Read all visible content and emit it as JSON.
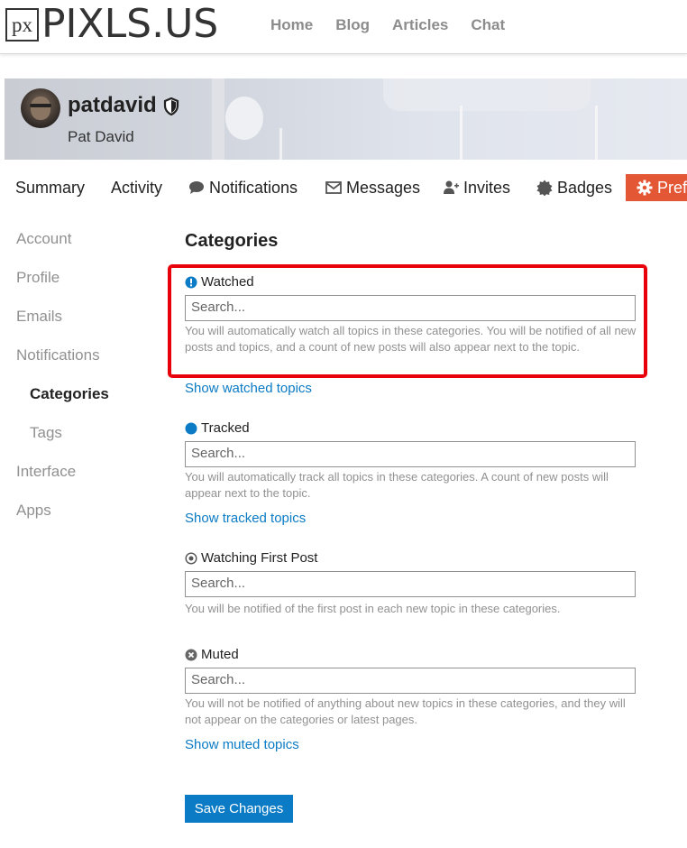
{
  "logo": {
    "mark": "px",
    "text": "PIXLS.US"
  },
  "topnav": [
    "Home",
    "Blog",
    "Articles",
    "Chat"
  ],
  "profile": {
    "username": "patdavid",
    "real_name": "Pat David"
  },
  "tabs": {
    "summary": "Summary",
    "activity": "Activity",
    "notifications": "Notifications",
    "messages": "Messages",
    "invites": "Invites",
    "badges": "Badges",
    "preferences": "Preferences"
  },
  "sidebar": [
    "Account",
    "Profile",
    "Emails",
    "Notifications",
    "Categories",
    "Tags",
    "Interface",
    "Apps"
  ],
  "content": {
    "title": "Categories",
    "search_placeholder": "Search...",
    "watched": {
      "label": "Watched",
      "description": "You will automatically watch all topics in these categories. You will be notified of all new posts and topics, and a count of new posts will also appear next to the topic.",
      "link": "Show watched topics"
    },
    "tracked": {
      "label": "Tracked",
      "description": "You will automatically track all topics in these categories. A count of new posts will appear next to the topic.",
      "link": "Show tracked topics"
    },
    "watching_first_post": {
      "label": "Watching First Post",
      "description": "You will be notified of the first post in each new topic in these categories."
    },
    "muted": {
      "label": "Muted",
      "description": "You will not be notified of anything about new topics in these categories, and they will not appear on the categories or latest pages.",
      "link": "Show muted topics"
    },
    "save_button": "Save Changes"
  },
  "colors": {
    "accent": "#e45735",
    "link": "#0a7bc4",
    "highlight": "#e8000b"
  }
}
